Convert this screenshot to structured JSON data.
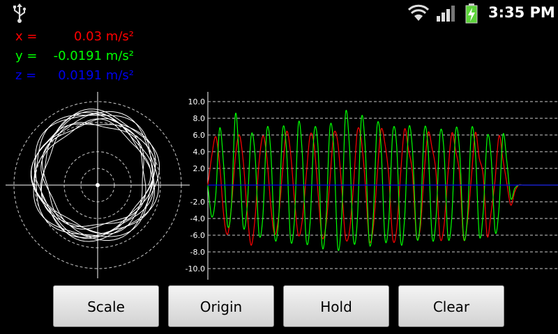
{
  "status_bar": {
    "time": "3:35 PM",
    "icons": [
      "usb-icon",
      "wifi-icon",
      "signal-icon",
      "battery-charging-icon"
    ]
  },
  "readouts": {
    "x": {
      "label": "x =",
      "value": "0.03 m/s²",
      "color": "#ff0000"
    },
    "y": {
      "label": "y =",
      "value": "-0.0191 m/s²",
      "color": "#00ff00"
    },
    "z": {
      "label": "z =",
      "value": "0.0191 m/s²",
      "color": "#0000ee"
    }
  },
  "buttons": {
    "scale": "Scale",
    "origin": "Origin",
    "hold": "Hold",
    "clear": "Clear"
  },
  "chart_data": {
    "type": "line",
    "ylim": [
      -10.0,
      10.0
    ],
    "yticks": [
      "10.0",
      "8.0",
      "6.0",
      "4.0",
      "2.0",
      "-2.0",
      "-4.0",
      "-6.0",
      "-8.0",
      "-10.0"
    ],
    "grid": true,
    "series": [
      {
        "color": "#ff0000",
        "values": [
          0,
          3.5,
          5.8,
          2.5,
          -3.5,
          -5.9,
          -2.5,
          3.4,
          6.0,
          2.8,
          -3.2,
          -7.2,
          -3.9,
          2.6,
          5.9,
          3.3,
          -2.5,
          -5.9,
          -3.7,
          1.8,
          6.4,
          4.0,
          -1.7,
          -6.0,
          -4.2,
          1.1,
          6.0,
          4.8,
          -0.8,
          -6.2,
          -4.9,
          0.4,
          6.1,
          5.2,
          -0.2,
          -6.3,
          -5.5,
          -0.2,
          6.5,
          5.4,
          0.3,
          -6.5,
          -5.3,
          0.8,
          6.6,
          5.0,
          1.0,
          -6.4,
          -5.3,
          1.4,
          6.7,
          4.2,
          1.5,
          -6.0,
          -5.1,
          1.6,
          6.3,
          4.4,
          1.5,
          -6.2,
          -5.0,
          1.2,
          6.2,
          4.1,
          1.3,
          -6.4,
          -4.3,
          1.0,
          6.3,
          3.2,
          1.1,
          -6.1,
          -3.3,
          0.6,
          5.9,
          3.1,
          0.2,
          -2.4,
          -0.8,
          0,
          0,
          0,
          0,
          0,
          0,
          0,
          0,
          0,
          0,
          0
        ]
      },
      {
        "color": "#00ff00",
        "values": [
          0,
          -3.8,
          -1.2,
          6.8,
          2.4,
          -4.8,
          -2.4,
          8.5,
          3.0,
          -5.0,
          -2.6,
          5.9,
          3.6,
          -5.8,
          -3.6,
          6.6,
          4.0,
          -6.2,
          -4.0,
          6.6,
          4.2,
          -6.4,
          -4.2,
          7.3,
          3.8,
          -6.6,
          -4.4,
          6.3,
          4.6,
          -7.1,
          -4.5,
          6.8,
          4.5,
          -7.4,
          -4.0,
          8.6,
          4.5,
          -6.5,
          -4.2,
          7.9,
          4.6,
          -6.8,
          -4.2,
          7.0,
          4.8,
          -6.3,
          -4.2,
          6.3,
          4.7,
          -6.7,
          -4.1,
          6.6,
          4.3,
          -5.9,
          -4.4,
          6.5,
          4.3,
          -6.2,
          -4.0,
          6.1,
          4.3,
          -6.1,
          -3.9,
          6.5,
          4.0,
          -6.2,
          -3.7,
          6.6,
          3.9,
          -6.0,
          -3.2,
          5.7,
          3.4,
          -5.5,
          -2.8,
          6.0,
          2.8,
          -1.6,
          -0.4,
          0,
          0,
          0,
          0,
          0,
          0,
          0,
          0,
          0,
          0,
          0
        ]
      },
      {
        "color": "#0000ee",
        "values": [
          0,
          0,
          0,
          0,
          0,
          0,
          0,
          0,
          0,
          0,
          0,
          0,
          0,
          0,
          0,
          0,
          0,
          0,
          0,
          0,
          0,
          0,
          0,
          0,
          0,
          0,
          0,
          0,
          0,
          0,
          0,
          0,
          0,
          0,
          0,
          0,
          0,
          0,
          0,
          0,
          0,
          0,
          0,
          0,
          0,
          0,
          0,
          0,
          0,
          0,
          0,
          0,
          0,
          0,
          0,
          0,
          0,
          0,
          0,
          0,
          0,
          0,
          0,
          0,
          0,
          0,
          0,
          0,
          0,
          0,
          0,
          0,
          0,
          0,
          0,
          0,
          0,
          0,
          0,
          0,
          0,
          0,
          0,
          0,
          0,
          0,
          0,
          0,
          0,
          0
        ]
      }
    ]
  }
}
